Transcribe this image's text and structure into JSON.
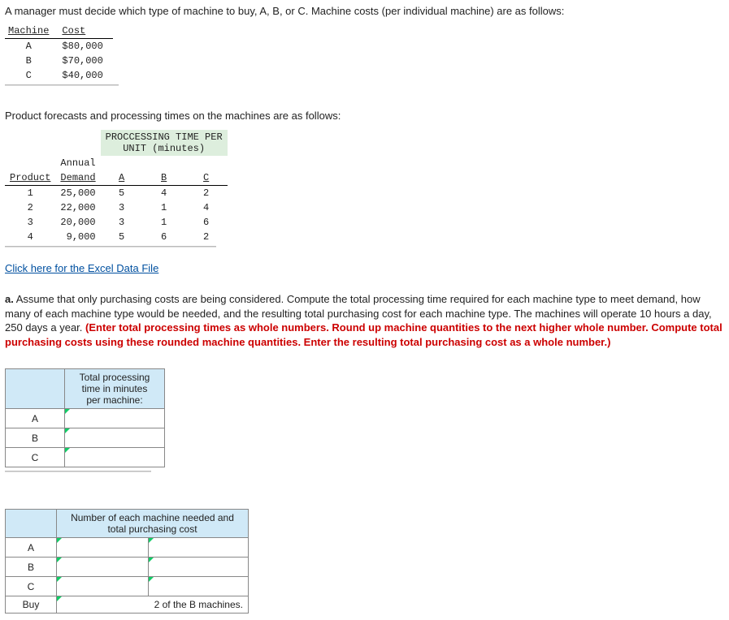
{
  "intro1": "A manager must decide which type of machine to buy, A, B, or C. Machine costs (per individual machine) are as follows:",
  "costTable": {
    "h1": "Machine",
    "h2": "Cost",
    "rows": [
      {
        "m": "A",
        "c": "$80,000"
      },
      {
        "m": "B",
        "c": "$70,000"
      },
      {
        "m": "C",
        "c": "$40,000"
      }
    ]
  },
  "intro2": "Product forecasts and processing times on the machines are as follows:",
  "procTable": {
    "topHeader": "PROCCESSING TIME PER\nUNIT (minutes)",
    "annual": "Annual",
    "colProduct": "Product",
    "colDemand": "Demand",
    "colA": "A",
    "colB": "B",
    "colC": "C",
    "rows": [
      {
        "p": "1",
        "d": "25,000",
        "a": "5",
        "b": "4",
        "c": "2"
      },
      {
        "p": "2",
        "d": "22,000",
        "a": "3",
        "b": "1",
        "c": "4"
      },
      {
        "p": "3",
        "d": "20,000",
        "a": "3",
        "b": "1",
        "c": "6"
      },
      {
        "p": "4",
        "d": "9,000",
        "a": "5",
        "b": "6",
        "c": "2"
      }
    ]
  },
  "excelLink": "Click here for the Excel Data File",
  "partA_lead": "a.",
  "partA_body": " Assume that only purchasing costs are being considered. Compute the total processing time required for each machine type to meet demand, how many of each machine type would be needed, and the resulting total purchasing cost for each machine type. The machines will operate 10 hours a day, 250 days a year. ",
  "partA_red": "(Enter total processing times as whole numbers. Round up machine quantities to the next higher whole number. Compute total purchasing costs using these rounded machine quantities. Enter the resulting total purchasing cost as a whole number.)",
  "ans1": {
    "header": "Total processing\ntime in minutes\nper machine:",
    "rows": [
      "A",
      "B",
      "C"
    ]
  },
  "ans2": {
    "header": "Number of each machine needed and\ntotal purchasing cost",
    "rows": [
      "A",
      "B",
      "C",
      "Buy"
    ],
    "buyValue": "2 of the B machines."
  }
}
